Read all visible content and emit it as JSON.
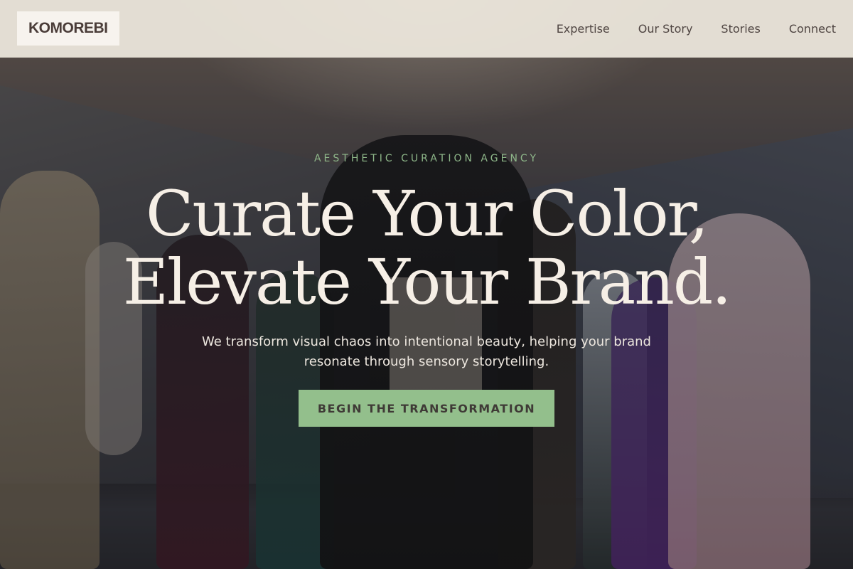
{
  "header": {
    "logo": "KOMOREBI",
    "nav": [
      {
        "label": "Expertise"
      },
      {
        "label": "Our Story"
      },
      {
        "label": "Stories"
      },
      {
        "label": "Connect"
      }
    ]
  },
  "hero": {
    "eyebrow": "AESTHETIC CURATION AGENCY",
    "headline_line1": "Curate Your Color,",
    "headline_line2": "Elevate Your Brand.",
    "subtitle": "We transform visual chaos into intentional beauty, helping your brand resonate through sensory storytelling.",
    "cta_label": "BEGIN THE TRANSFORMATION"
  },
  "colors": {
    "accent_green": "#93bf8c",
    "eyebrow_green": "#8fb88a",
    "header_bg": "#eee8de",
    "headline": "#f6efe6",
    "dark_text": "#4a3c38"
  }
}
